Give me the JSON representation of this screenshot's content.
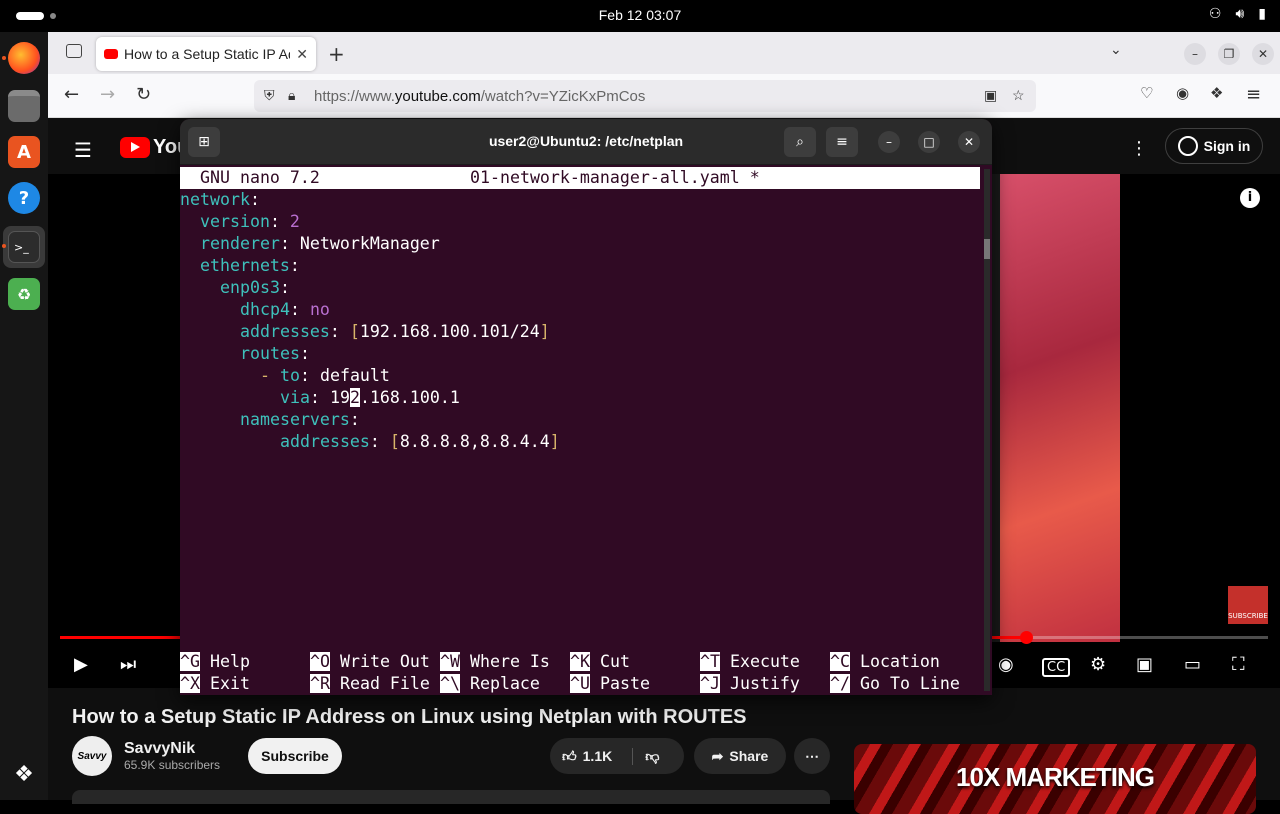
{
  "system": {
    "clock": "Feb 12  03:07"
  },
  "browser": {
    "tab_title": "How to a Setup Static IP Address on Linux using Netplan with ROUTES - YouTube",
    "url_prefix": "https://www.",
    "url_domain": "youtube.com",
    "url_path": "/watch?v=YZicKxPmCos"
  },
  "youtube": {
    "logo_text": "You",
    "sign_in": "Sign in",
    "video_title": "How to a Setup Static IP Address on Linux using Netplan with ROUTES",
    "channel_name": "SavvyNik",
    "channel_avatar_text": "Savvy",
    "subscriber_count": "65.9K subscribers",
    "subscribe_label": "Subscribe",
    "likes": "1.1K",
    "share_label": "Share",
    "ad_brand": "10X MARKETING",
    "subscribe_badge": "SUBSCRIBE",
    "progress_fraction": 0.8
  },
  "terminal": {
    "title": "user2@Ubuntu2: /etc/netplan",
    "nano_version": "GNU nano 7.2",
    "filename": "01-network-manager-all.yaml *",
    "lines": {
      "l1_key": "network",
      "l2_key": "version",
      "l2_val": "2",
      "l3_key": "renderer",
      "l3_val": "NetworkManager",
      "l4_key": "ethernets",
      "l5_key": "enp0s3",
      "l6_key": "dhcp4",
      "l6_val": "no",
      "l7_key": "addresses",
      "l7_val": "192.168.100.101/24",
      "l8_key": "routes",
      "l9_key": "to",
      "l9_val": "default",
      "l10_key": "via",
      "l10_val_a": "19",
      "l10_cursor": "2",
      "l10_val_b": ".168.100.1",
      "l11_key": "nameservers",
      "l12_key": "addresses",
      "l12_val": "8.8.8.8,8.8.4.4"
    },
    "shortcuts": [
      {
        "key": "^G",
        "label": "Help"
      },
      {
        "key": "^O",
        "label": "Write Out"
      },
      {
        "key": "^W",
        "label": "Where Is"
      },
      {
        "key": "^K",
        "label": "Cut"
      },
      {
        "key": "^T",
        "label": "Execute"
      },
      {
        "key": "^C",
        "label": "Location"
      },
      {
        "key": "^X",
        "label": "Exit"
      },
      {
        "key": "^R",
        "label": "Read File"
      },
      {
        "key": "^\\",
        "label": "Replace"
      },
      {
        "key": "^U",
        "label": "Paste"
      },
      {
        "key": "^J",
        "label": "Justify"
      },
      {
        "key": "^/",
        "label": "Go To Line"
      }
    ]
  },
  "colors": {
    "terminal_bg": "#300a24",
    "yaml_key": "#3ec1bb",
    "youtube_red": "#ff0000",
    "ubuntu_orange": "#e95420"
  }
}
